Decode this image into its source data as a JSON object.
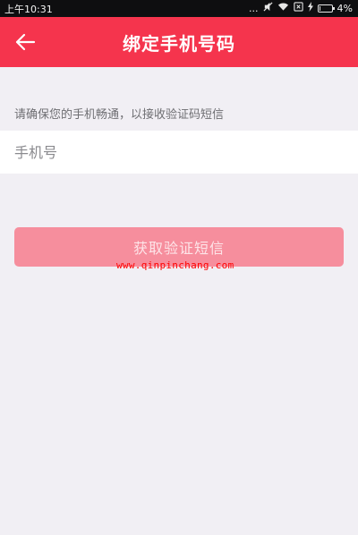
{
  "status_bar": {
    "time": "上午10:31",
    "signal_dots": "...",
    "battery_percent": "4%"
  },
  "header": {
    "title": "绑定手机号码",
    "back_icon": "arrow-left-icon"
  },
  "hint": "请确保您的手机畅通，以接收验证码短信",
  "phone_input": {
    "placeholder": "手机号",
    "value": ""
  },
  "button": {
    "label": "获取验证短信"
  },
  "watermark": "www.qinpinchang.com",
  "colors": {
    "header": "#f5344d",
    "button": "#f68e9d",
    "background": "#f1eff4"
  }
}
